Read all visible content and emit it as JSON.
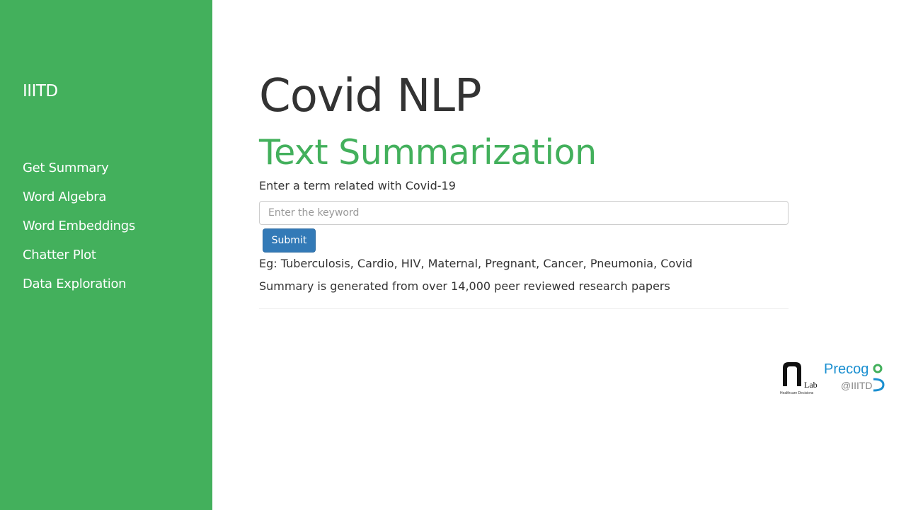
{
  "sidebar": {
    "brand": "IIITD",
    "items": [
      {
        "label": "Get Summary"
      },
      {
        "label": "Word Algebra"
      },
      {
        "label": "Word Embeddings"
      },
      {
        "label": "Chatter Plot"
      },
      {
        "label": "Data Exploration"
      }
    ]
  },
  "main": {
    "title": "Covid NLP",
    "subtitle": "Text Summarization",
    "prompt": "Enter a term related with Covid-19",
    "search": {
      "placeholder": "Enter the keyword",
      "value": ""
    },
    "submit_label": "Submit",
    "examples": "Eg: Tuberculosis, Cardio, HIV, Maternal, Pregnant, Cancer, Pneumonia, Covid",
    "note": "Summary is generated from over 14,000 peer reviewed research papers"
  },
  "logos": {
    "hd_lab": {
      "main": "Lab",
      "caption": "Healthcare Decisions"
    },
    "precog": {
      "main": "Precog",
      "suffix": "@IIITD"
    }
  },
  "colors": {
    "sidebar": "#43b05c",
    "accent": "#43b05c",
    "button": "#337ab7",
    "text": "#333333",
    "precog_blue": "#1a8fd0",
    "precog_green": "#43b05c"
  }
}
